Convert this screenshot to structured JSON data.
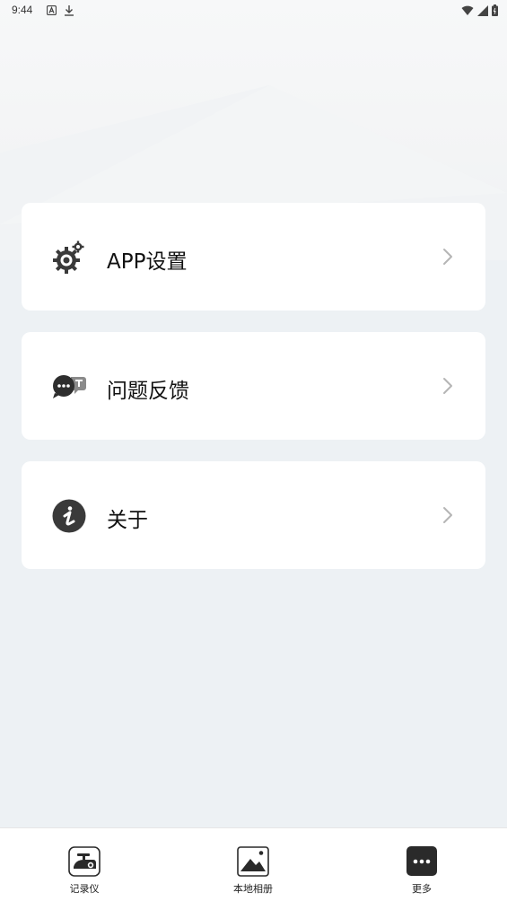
{
  "status_bar": {
    "time": "9:44"
  },
  "menu": [
    {
      "label": "APP设置",
      "icon": "gear-settings-icon"
    },
    {
      "label": "问题反馈",
      "icon": "chat-feedback-icon"
    },
    {
      "label": "关于",
      "icon": "info-icon"
    }
  ],
  "tabbar": {
    "tabs": [
      {
        "label": "记录仪",
        "icon": "dashcam-icon",
        "selected": false
      },
      {
        "label": "本地相册",
        "icon": "album-icon",
        "selected": false
      },
      {
        "label": "更多",
        "icon": "more-icon",
        "selected": true
      }
    ]
  },
  "colors": {
    "background": "#edf1f4",
    "card": "#ffffff",
    "icon_dark": "#3a3a3a",
    "chevron": "#b5b5b5"
  }
}
